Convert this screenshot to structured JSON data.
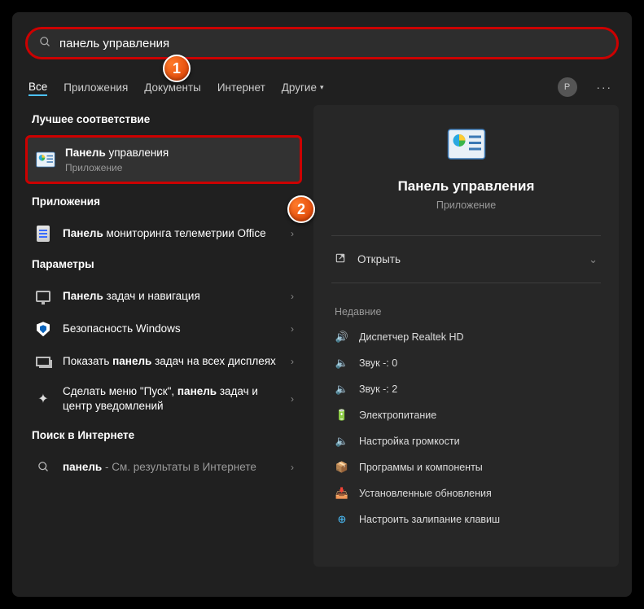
{
  "search": {
    "value": "панель управления"
  },
  "tabs": {
    "all": "Все",
    "apps": "Приложения",
    "docs": "Документы",
    "web": "Интернет",
    "other": "Другие",
    "avatar_letter": "P"
  },
  "sections": {
    "best": "Лучшее соответствие",
    "apps": "Приложения",
    "settings": "Параметры",
    "web": "Поиск в Интернете"
  },
  "best_match": {
    "title_bold": "Панель",
    "title_rest": " управления",
    "subtitle": "Приложение"
  },
  "apps_list": [
    {
      "bold": "Панель",
      "rest": " мониторинга телеметрии Office"
    }
  ],
  "settings_list": [
    {
      "bold": "Панель",
      "rest": " задач и навигация",
      "icon": "monitor"
    },
    {
      "bold": "",
      "rest": "Безопасность Windows",
      "icon": "shield"
    },
    {
      "bold": "панель",
      "prefix": "Показать ",
      "rest": " задач на всех дисплеях",
      "icon": "displays"
    },
    {
      "bold": "панель",
      "prefix": "Сделать меню \"Пуск\", ",
      "rest": " задач и центр уведомлений",
      "icon": "spark"
    }
  ],
  "web_list": [
    {
      "bold": "панель",
      "tail": " - См. результаты в Интернете"
    }
  ],
  "preview": {
    "title": "Панель управления",
    "subtitle": "Приложение",
    "open": "Открыть",
    "recent_title": "Недавние",
    "recent": [
      "Диспетчер Realtek HD",
      "Звук -: 0",
      "Звук -: 2",
      "Электропитание",
      "Настройка громкости",
      "Программы и компоненты",
      "Установленные обновления",
      "Настроить залипание клавиш"
    ]
  }
}
